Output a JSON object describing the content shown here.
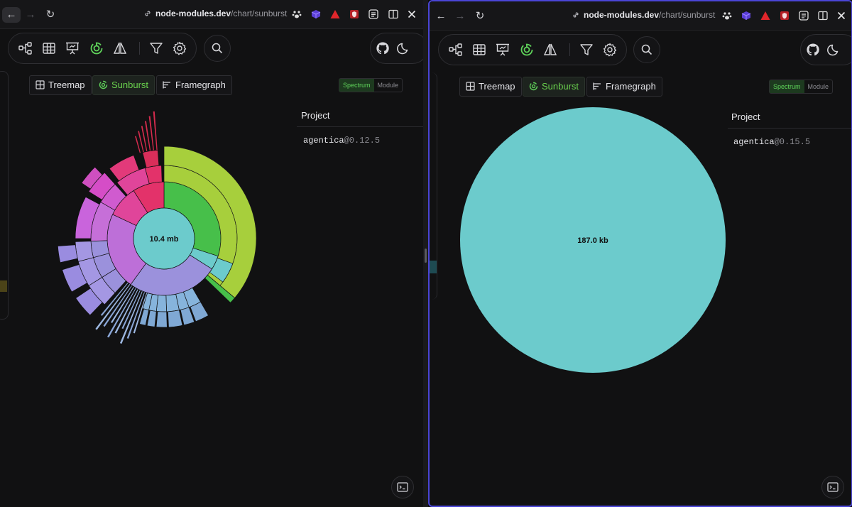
{
  "left": {
    "url": {
      "domain": "node-modules.dev",
      "path": "/chart/sunburst"
    },
    "tabs": [
      "Treemap",
      "Sunburst",
      "Framegraph"
    ],
    "active_tab": "Sunburst",
    "segmented": {
      "options": [
        "Spectrum",
        "Module"
      ],
      "selected": "Spectrum"
    },
    "project": {
      "heading": "Project",
      "name": "agentica",
      "version": "@0.12.5"
    },
    "center_label": "10.4 mb"
  },
  "right": {
    "url": {
      "domain": "node-modules.dev",
      "path": "/chart/sunburst"
    },
    "tabs": [
      "Treemap",
      "Sunburst",
      "Framegraph"
    ],
    "active_tab": "Sunburst",
    "segmented": {
      "options": [
        "Spectrum",
        "Module"
      ],
      "selected": "Spectrum"
    },
    "project": {
      "heading": "Project",
      "name": "agentica",
      "version": "@0.15.5"
    },
    "center_label": "187.0 kb"
  },
  "icons": [
    "back-arrow-icon",
    "forward-arrow-icon",
    "reload-icon",
    "link-icon",
    "graph-icon",
    "table-icon",
    "presentation-icon",
    "sunburst-icon",
    "compare-icon",
    "filter-icon",
    "gear-icon",
    "search-icon",
    "github-icon",
    "moon-icon",
    "terminal-icon",
    "treemap-icon",
    "framegraph-icon"
  ],
  "colors": {
    "accent": "#5fd35a",
    "window_border": "#4a45d6",
    "sunburst_center": "#6ccbcc"
  },
  "chart_data": [
    {
      "type": "sunburst",
      "center": "10.4 mb",
      "rings": {
        "root": {
          "label": "10.4 mb",
          "color": "#6ccbcc"
        },
        "level1": [
          {
            "share": 0.3,
            "color": "#47bf4a"
          },
          {
            "share": 0.04,
            "color": "#6ccbcc"
          },
          {
            "share": 0.26,
            "color": "#9b91dc"
          },
          {
            "share": 0.22,
            "color": "#bd6fd8"
          },
          {
            "share": 0.09,
            "color": "#e0459a"
          },
          {
            "share": 0.09,
            "color": "#e3326a"
          }
        ],
        "outer_dominant": {
          "share": 0.36,
          "color": "#a7cf3c"
        }
      }
    },
    {
      "type": "sunburst",
      "center": "187.0 kb",
      "rings": {
        "root": {
          "label": "187.0 kb",
          "color": "#6ccbcc"
        }
      }
    }
  ]
}
